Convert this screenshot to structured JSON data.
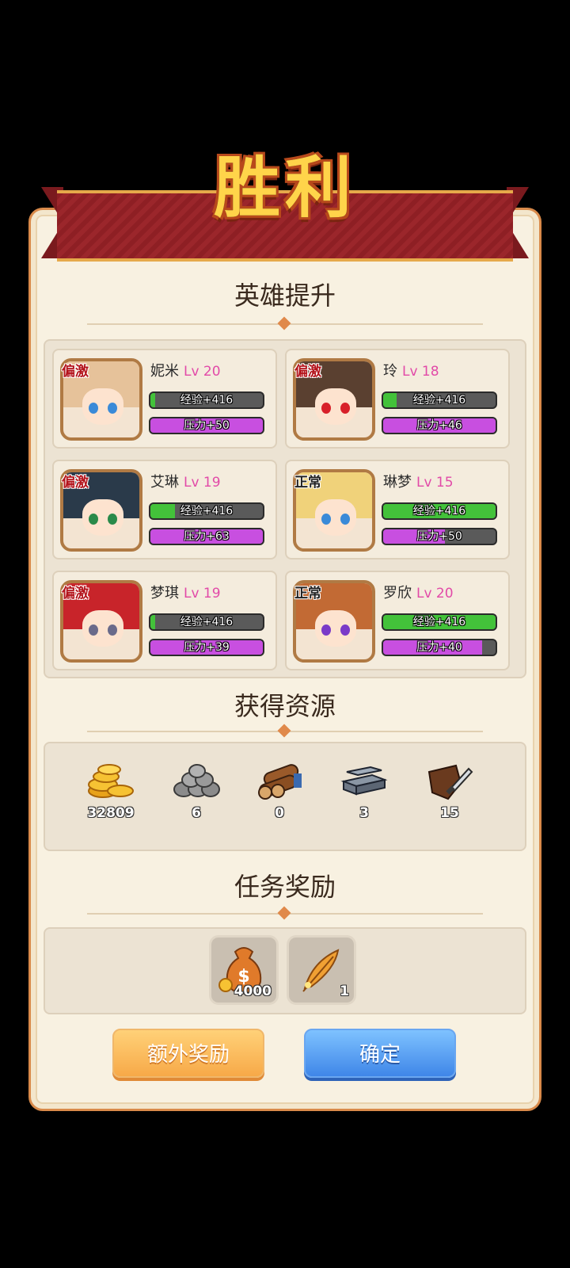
{
  "header": {
    "title": "胜利"
  },
  "sections": {
    "heroes_title": "英雄提升",
    "resources_title": "获得资源",
    "missions_title": "任务奖励"
  },
  "heroes": [
    {
      "name": "妮米",
      "level": "Lv 20",
      "tag": "偏激",
      "exp_label": "经验+416",
      "exp_fill": 0.04,
      "stress_label": "压力+50",
      "stress_fill": 1.0
    },
    {
      "name": "玲",
      "level": "Lv 18",
      "tag": "偏激",
      "exp_label": "经验+416",
      "exp_fill": 0.12,
      "stress_label": "压力+46",
      "stress_fill": 1.0
    },
    {
      "name": "艾琳",
      "level": "Lv 19",
      "tag": "偏激",
      "exp_label": "经验+416",
      "exp_fill": 0.22,
      "stress_label": "压力+63",
      "stress_fill": 1.0
    },
    {
      "name": "琳梦",
      "level": "Lv 15",
      "tag": "正常",
      "exp_label": "经验+416",
      "exp_fill": 1.0,
      "stress_label": "压力+50",
      "stress_fill": 0.55
    },
    {
      "name": "梦琪",
      "level": "Lv 19",
      "tag": "偏激",
      "exp_label": "经验+416",
      "exp_fill": 0.04,
      "stress_label": "压力+39",
      "stress_fill": 1.0
    },
    {
      "name": "罗欣",
      "level": "Lv 20",
      "tag": "正常",
      "exp_label": "经验+416",
      "exp_fill": 1.0,
      "stress_label": "压力+40",
      "stress_fill": 0.88
    }
  ],
  "resources": [
    {
      "icon": "gold-coins-icon",
      "count": "32809"
    },
    {
      "icon": "stone-icon",
      "count": "6"
    },
    {
      "icon": "wood-icon",
      "count": "0"
    },
    {
      "icon": "iron-icon",
      "count": "3"
    },
    {
      "icon": "leather-icon",
      "count": "15"
    }
  ],
  "mission_rewards": [
    {
      "icon": "money-bag-icon",
      "count": "4000"
    },
    {
      "icon": "feather-icon",
      "count": "1"
    }
  ],
  "buttons": {
    "extra_reward": "额外奖励",
    "confirm": "确定"
  },
  "colors": {
    "exp_green": "#43c23a",
    "stress_purple": "#c84fe0",
    "level_pink": "#e24aa8",
    "tag_red": "#b3121a"
  }
}
